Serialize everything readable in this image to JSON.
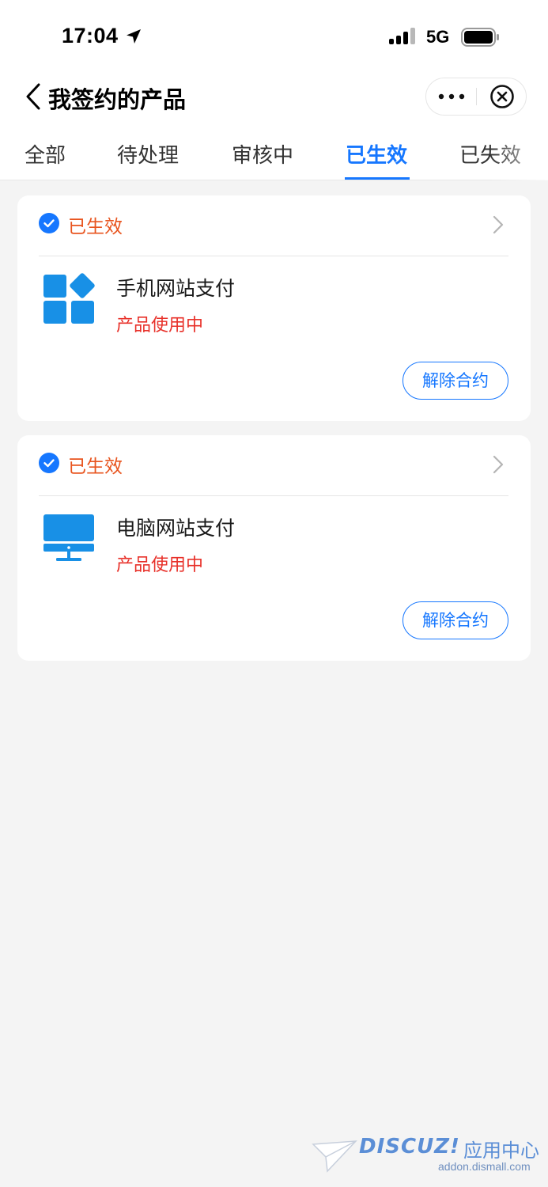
{
  "status_bar": {
    "time": "17:04",
    "network": "5G"
  },
  "nav": {
    "title": "我签约的产品"
  },
  "tabs": [
    {
      "label": "全部",
      "active": false
    },
    {
      "label": "待处理",
      "active": false
    },
    {
      "label": "审核中",
      "active": false
    },
    {
      "label": "已生效",
      "active": true
    },
    {
      "label": "已失效",
      "active": false
    }
  ],
  "contracts": [
    {
      "status": "已生效",
      "product_name": "手机网站支付",
      "product_status": "产品使用中",
      "action_label": "解除合约",
      "icon": "app-grid-icon"
    },
    {
      "status": "已生效",
      "product_name": "电脑网站支付",
      "product_status": "产品使用中",
      "action_label": "解除合约",
      "icon": "desktop-computer-icon"
    }
  ],
  "watermark": {
    "logo": "DISCUZ!",
    "name": "应用中心",
    "url": "addon.dismall.com"
  },
  "colors": {
    "accent": "#1677ff",
    "status_orange": "#e8541e",
    "status_red": "#e8312a",
    "product_icon": "#1890e6"
  }
}
